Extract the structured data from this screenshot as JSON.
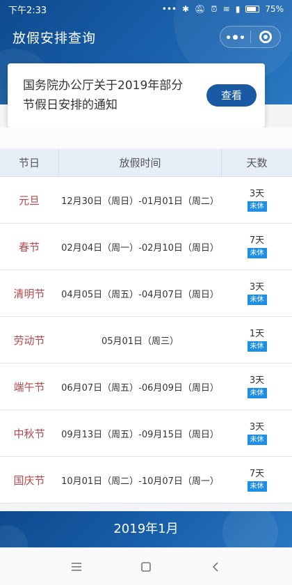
{
  "status_bar": {
    "time": "下午2:33",
    "battery": "75%",
    "icons": [
      "dots-icon",
      "bluetooth-icon",
      "mute-icon",
      "alarm-icon",
      "wifi-icon",
      "signal-icon",
      "battery-icon"
    ]
  },
  "header": {
    "title": "放假安排查询",
    "accent": "#1a5aa3"
  },
  "notice": {
    "line1": "国务院办公厅关于2019年部分",
    "line2": "节假日安排的通知",
    "button_label": "查看"
  },
  "table": {
    "headers": [
      "节日",
      "放假时间",
      "天数"
    ],
    "rows": [
      {
        "holiday": "元旦",
        "period": "12月30日（周日）-01月01日（周二）",
        "days": "3天",
        "badge": "未休"
      },
      {
        "holiday": "春节",
        "period": "02月04日（周一）-02月10日（周日）",
        "days": "7天",
        "badge": "未休"
      },
      {
        "holiday": "清明节",
        "period": "04月05日（周五）-04月07日（周日）",
        "days": "3天",
        "badge": "未休"
      },
      {
        "holiday": "劳动节",
        "period": "05月01日（周三）",
        "days": "1天",
        "badge": "未休"
      },
      {
        "holiday": "端午节",
        "period": "06月07日（周五）-06月09日（周日）",
        "days": "3天",
        "badge": "未休"
      },
      {
        "holiday": "中秋节",
        "period": "09月13日（周五）-09月15日（周日）",
        "days": "3天",
        "badge": "未休"
      },
      {
        "holiday": "国庆节",
        "period": "10月01日（周二）-10月07日（周一）",
        "days": "7天",
        "badge": "未休"
      }
    ],
    "holiday_color": "#b5474a",
    "badge_color": "#1e8fe6"
  },
  "month_banner": {
    "label": "2019年1月"
  }
}
